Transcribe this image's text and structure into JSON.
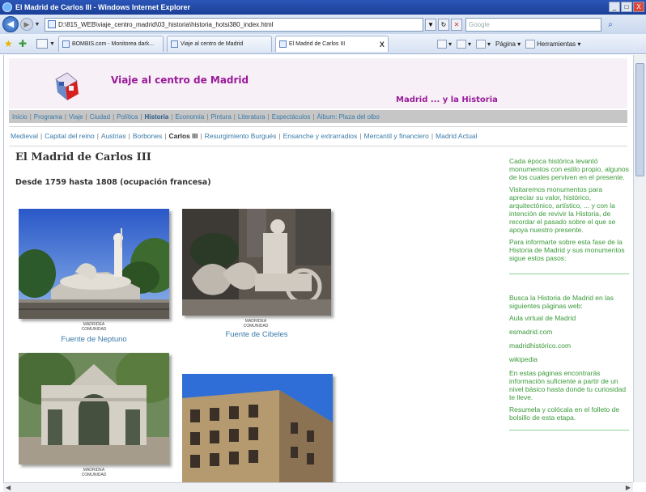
{
  "browser": {
    "window_title": "El Madrid de Carlos III - Windows Internet Explorer",
    "url": "D:\\815_WEB\\viaje_centro_madrid\\03_historia\\historia_hotsi380_index.html",
    "search_placeholder": "Google",
    "window_buttons": [
      "_",
      "□",
      "X"
    ],
    "tabs": [
      {
        "label": "BOMBIS.com - Monitorea dark..."
      },
      {
        "label": "Viaje al centro de Madrid"
      },
      {
        "label": "El Madrid de Carlos III",
        "close": "X"
      }
    ],
    "commands": {
      "page": "Página",
      "tools": "Herramientas"
    }
  },
  "header": {
    "site_title": "Viaje al centro de Madrid",
    "site_subtitle": "Madrid ... y la Historia"
  },
  "main_nav": {
    "items": [
      "Inicio",
      "Programa",
      "Viaje",
      "Ciudad",
      "Política",
      "Historia",
      "Economía",
      "Pintura",
      "Literatura",
      "Espectáculos",
      "Álbum: Plaza del olbo"
    ],
    "current": "Historia"
  },
  "sub_nav": {
    "items": [
      "Medieval",
      "Capital del reino",
      "Austrias",
      "Borbones",
      "Carlos III",
      "Resurgimiento Burgués",
      "Ensanche y extrarradios",
      "Mercantil y financiero",
      "Madrid Actual"
    ],
    "current": "Carlos III"
  },
  "content": {
    "heading": "El Madrid de Carlos III",
    "period": "Desde 1759 hasta 1808 (ocupación francesa)",
    "photos": [
      {
        "caption": "Fuente de Neptuno",
        "watermark": "MADRIDEA COMUNIDAD"
      },
      {
        "caption": "Fuente de Cibeles",
        "watermark": "MADRIDEA COMUNIDAD"
      },
      {
        "caption": "",
        "watermark": "MADRIDEA COMUNIDAD"
      },
      {
        "caption": "",
        "watermark": ""
      }
    ]
  },
  "sidebar": {
    "intro": [
      "Cada época histórica levantó monumentos con estilo propio, algunos de los cuales perviven en el presente.",
      "Visitaremos monumentos para apreciar su valor, histórico, arquitectónico, artístico, ... y con la intención de revivir la Historia, de recordar el pasado sobre el que se apoya nuestro presente.",
      "Para informarte sobre esta fase de la Historia de Madrid y sus monumentos sigue estos pasos:"
    ],
    "search_intro": "Busca la Historia de Madrid en las siguientes páginas web:",
    "links": [
      "Aula virtual de Madrid",
      "esmadrid.com",
      "madridhistórico.com",
      "wikipedia"
    ],
    "outro": [
      "En estas páginas encontrarás información suficiente a partir de un nivel básico hasta donde tu curiosidad te lleve.",
      "Resumela y colócala en el folleto de bolsillo de esta etapa."
    ]
  },
  "colors": {
    "site_title": "#9a1a9a",
    "link": "#3a7aa8",
    "sidebar_text": "#3a9a3a"
  }
}
